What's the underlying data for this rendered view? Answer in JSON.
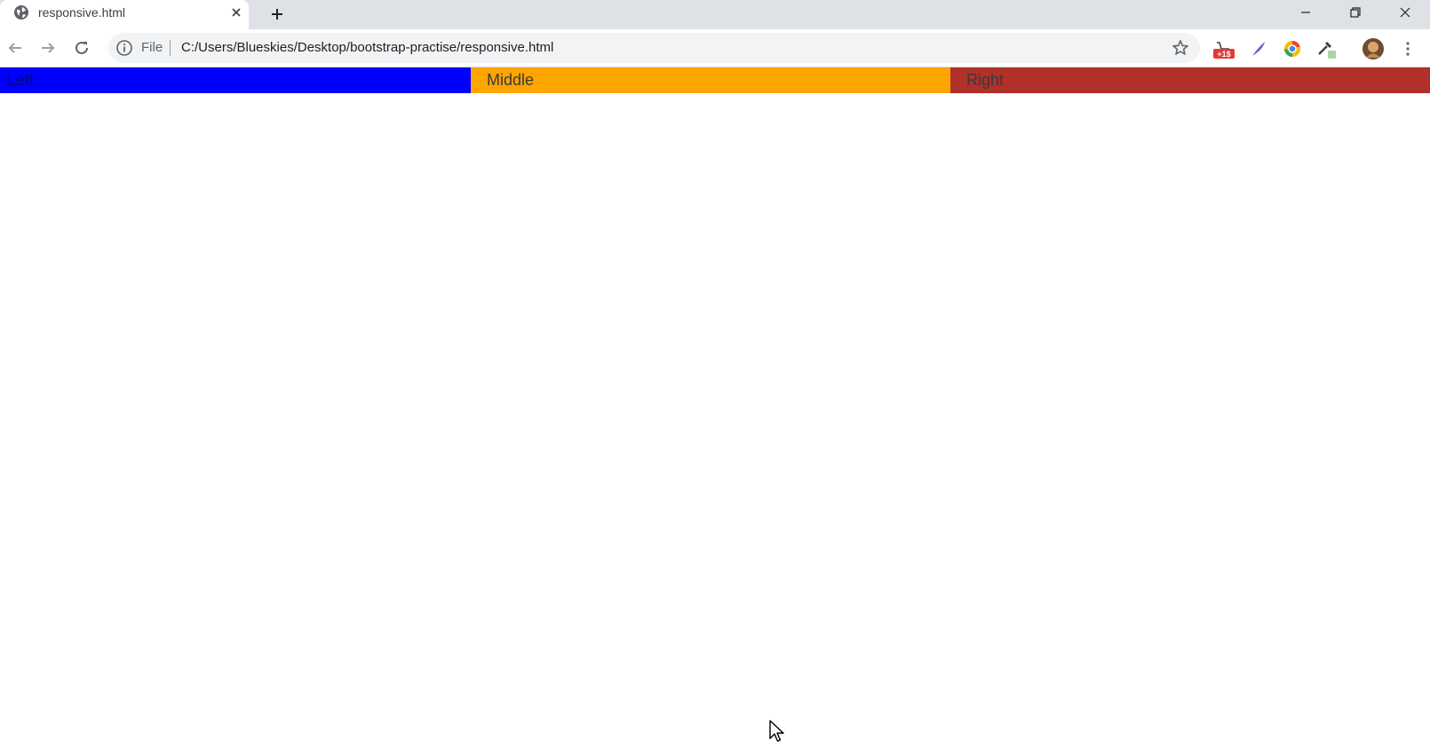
{
  "browser": {
    "tab": {
      "title": "responsive.html",
      "favicon": "globe-icon"
    },
    "new_tab_icon": "plus-icon",
    "window_controls": [
      "minimize-icon",
      "restore-icon",
      "close-icon"
    ]
  },
  "toolbar": {
    "scheme_label": "File",
    "url": "C:/Users/Blueskies/Desktop/bootstrap-practise/responsive.html",
    "extensions": [
      "cart-badge-icon",
      "feather-icon",
      "chrome-circle-icon",
      "eyedropper-icon"
    ],
    "extension_badge": "+1$"
  },
  "page": {
    "columns": [
      {
        "label": "Left",
        "color": "#0000ff"
      },
      {
        "label": "Middle",
        "color": "#ffa500"
      },
      {
        "label": "Right",
        "color": "#b03129"
      }
    ]
  }
}
